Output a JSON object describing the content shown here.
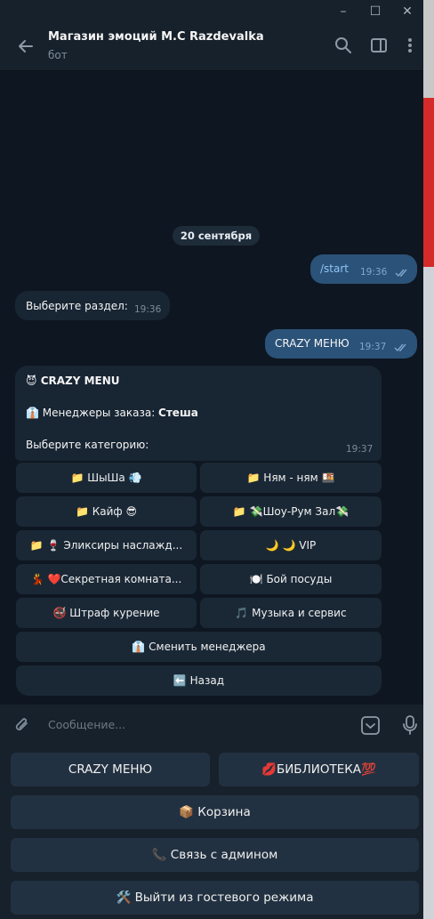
{
  "window": {
    "minimize": "–",
    "maximize": "☐",
    "close": "✕"
  },
  "header": {
    "title": "Магазин эмоций M.C Razdevalka",
    "subtitle": "бот"
  },
  "messages": {
    "date": "20 сентября",
    "start": {
      "text": "/start",
      "time": "19:36"
    },
    "choose_section": {
      "text": "Выберите раздел:",
      "time": "19:36"
    },
    "crazy_menu_out": {
      "text": "CRAZY МЕНЮ",
      "time": "19:37"
    },
    "menu_card": {
      "line1": "😈 CRAZY MENU",
      "line2_prefix": "👔 Менеджеры заказа: ",
      "line2_value": "Стеша",
      "line3": "Выберите категорию:",
      "time": "19:37"
    }
  },
  "inline_keyboard": [
    "📁 ШыШа 💨",
    "📁 Ням - ням 🍱",
    "📁 Кайф 😎",
    "📁 💸Шоу-Рум Зал💸",
    "📁 🍷 Эликсиры наслажд...",
    "🌙 🌙 VIP",
    "💃 ❤️Секретная комната...",
    "🍽️ Бой посуды",
    "🚭 Штраф курение",
    "🎵 Музыка и сервис",
    "👔 Сменить менеджера",
    "⬅️ Назад"
  ],
  "composer": {
    "placeholder": "Сообщение..."
  },
  "reply_keyboard": [
    "CRAZY МЕНЮ",
    "💋БИБЛИОТЕКА💯",
    "📦 Корзина",
    "📞 Связь с админом",
    "🛠️ Выйти из гостевого режима"
  ],
  "colors": {
    "background": "#0e1621",
    "header": "#17212b",
    "bubble_out": "#2b5278",
    "bubble_in": "#182533",
    "button": "#1a2836"
  }
}
